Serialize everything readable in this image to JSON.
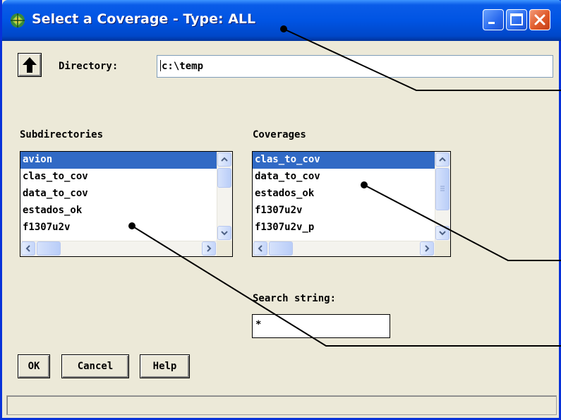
{
  "window": {
    "title": "Select a Coverage - Type: ALL",
    "icon": "app-icon",
    "controls": [
      "minimize-icon",
      "maximize-icon",
      "close-icon"
    ],
    "accent_color": "#0054e3",
    "close_color": "#e05a2a"
  },
  "directory": {
    "label": "Directory:",
    "value": "c:\\temp",
    "up_icon": "up-arrow-icon"
  },
  "subdirectories": {
    "label": "Subdirectories",
    "items": [
      "avion",
      "clas_to_cov",
      "data_to_cov",
      "estados_ok",
      "f1307u2v"
    ],
    "selected": "avion"
  },
  "coverages": {
    "label": "Coverages",
    "items": [
      "clas_to_cov",
      "data_to_cov",
      "estados_ok",
      "f1307u2v",
      "f1307u2v_p"
    ],
    "selected": "clas_to_cov"
  },
  "search": {
    "label": "Search string:",
    "value": "*"
  },
  "buttons": {
    "ok": "OK",
    "cancel": "Cancel",
    "help": "Help"
  },
  "colors": {
    "selection": "#316ac5",
    "dialog_bg": "#ece9d8"
  }
}
